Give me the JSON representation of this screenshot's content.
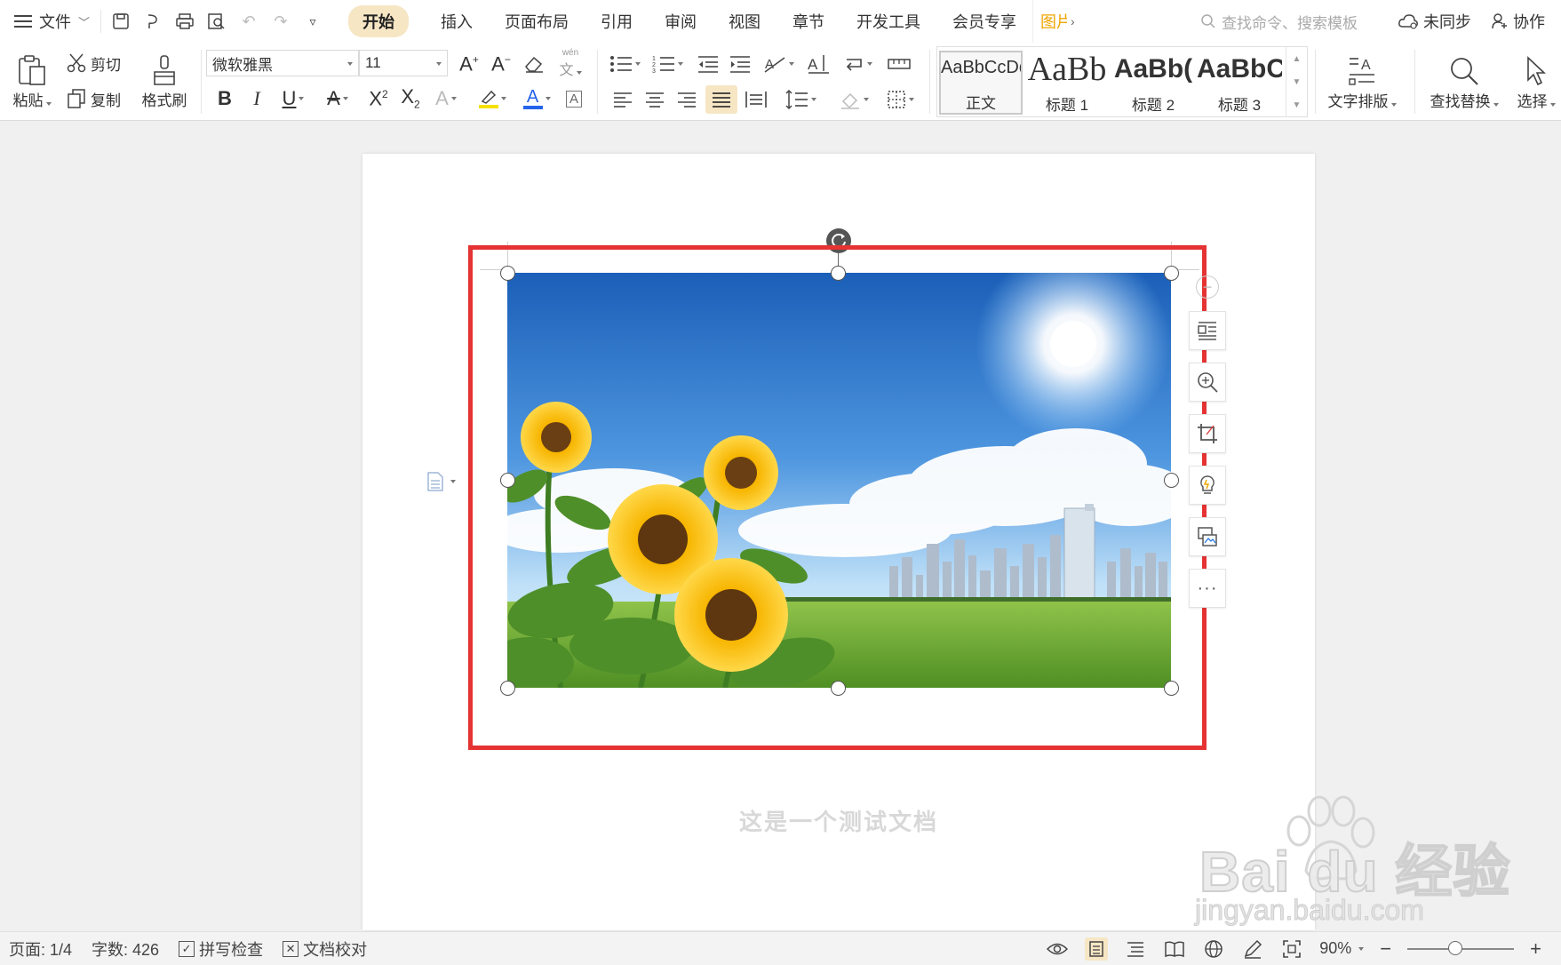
{
  "menubar": {
    "file_label": "文件",
    "tabs": [
      "开始",
      "插入",
      "页面布局",
      "引用",
      "审阅",
      "视图",
      "章节",
      "开发工具",
      "会员专享"
    ],
    "context_tab": "图片",
    "search_placeholder": "查找命令、搜索模板",
    "sync_label": "未同步",
    "collab_label": "协作"
  },
  "ribbon": {
    "paste_label": "粘贴",
    "cut_label": "剪切",
    "copy_label": "复制",
    "format_painter_label": "格式刷",
    "font_name": "微软雅黑",
    "font_size": "11",
    "phonetic_label": "wén",
    "styles": [
      {
        "sample": "AaBbCcDd",
        "name": "正文"
      },
      {
        "sample": "AaBb",
        "name": "标题 1"
      },
      {
        "sample": "AaBb(",
        "name": "标题 2"
      },
      {
        "sample": "AaBbC",
        "name": "标题 3"
      }
    ],
    "text_layout_label": "文字排版",
    "find_replace_label": "查找替换",
    "select_label": "选择"
  },
  "document": {
    "caption": "这是一个测试文档"
  },
  "watermark": {
    "title": "Bai du 经验",
    "url": "jingyan.baidu.com"
  },
  "statusbar": {
    "page": "页面: 1/4",
    "word_count": "字数: 426",
    "spell_check": "拼写检查",
    "doc_proof": "文档校对",
    "zoom": "90%",
    "zoom_fraction": 0.45
  },
  "colors": {
    "accent_tab": "#f7e6c4",
    "highlight_frame": "#e53333",
    "context_tab": "#f0a500",
    "font_color_bar": "#2563eb",
    "highlight_bar": "#f5e000"
  }
}
